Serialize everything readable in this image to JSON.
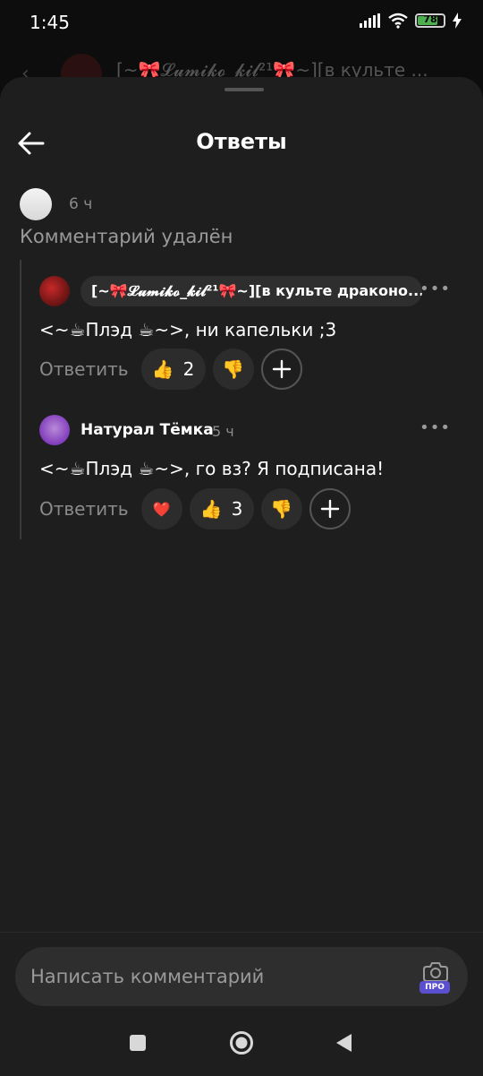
{
  "status_bar": {
    "time": "1:45",
    "battery": "78"
  },
  "background_header": {
    "title": "[~🎀𝓛𝓾𝓶𝓲𝓴𝓸_𝓴𝓲𝓵²¹🎀~][в культе ..."
  },
  "sheet": {
    "title": "Ответы"
  },
  "deleted_comment": {
    "time": "6 ч",
    "text": "Комментарий удалён"
  },
  "replies": [
    {
      "author": "[~🎀𝓛𝓾𝓶𝓲𝓴𝓸_𝓴𝓲𝓵²¹🎀~][в культе драконо...",
      "time": "",
      "text": "<~☕Плэд ☕~>, ни капельки ;3",
      "reply_label": "Ответить",
      "likes": "2",
      "like_icon": "👍",
      "dislike_icon": "👎"
    },
    {
      "author": "Натурал Тёмка",
      "time": "5 ч",
      "text": "<~☕Плэд ☕~>, го вз? Я подписана!",
      "reply_label": "Ответить",
      "likes": "3",
      "like_icon": "👍",
      "dislike_icon": "👎",
      "author_reaction_icon": "❤️"
    }
  ],
  "composer": {
    "placeholder": "Написать комментарий",
    "pro_badge": "ПРО"
  },
  "colors": {
    "sheet_bg": "#1e1e1e",
    "chip_bg": "#2e2e2e",
    "muted_text": "#8a8a8a",
    "pro_accent": "#5a4fcf"
  }
}
